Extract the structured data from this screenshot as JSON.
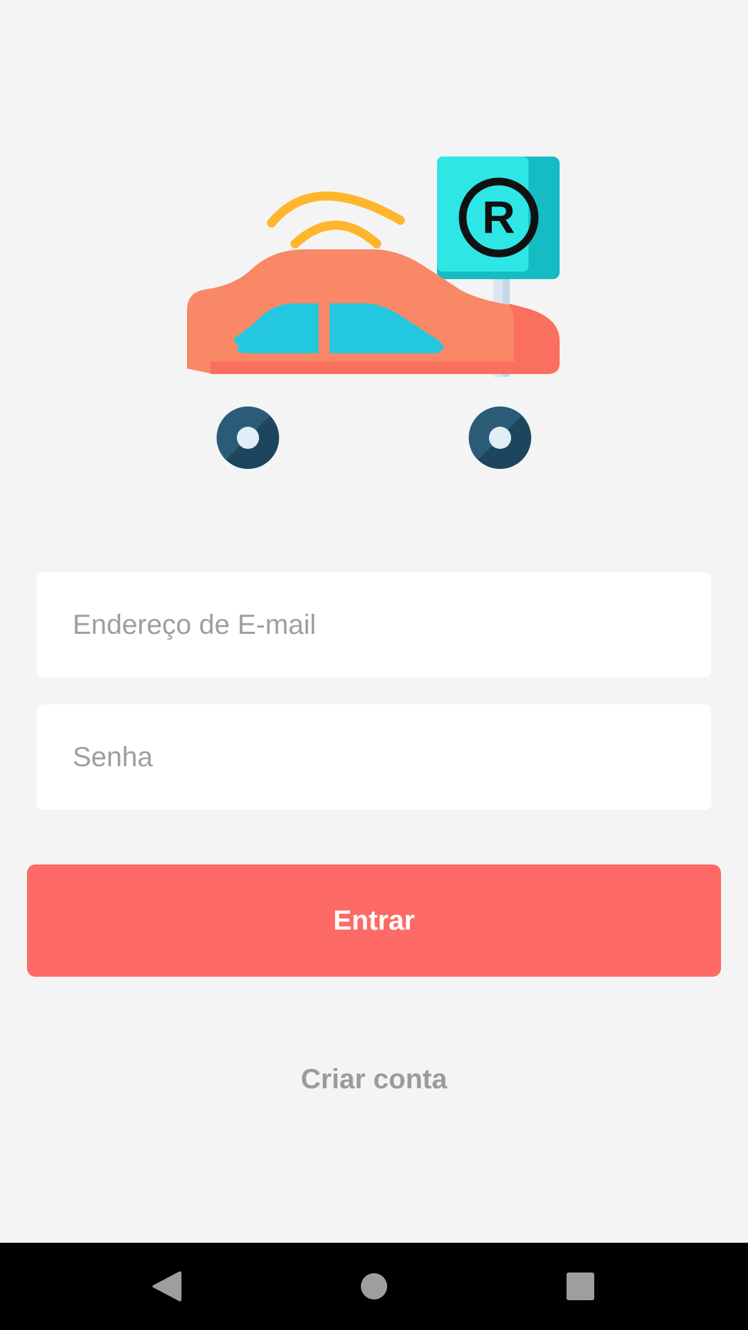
{
  "logo": {
    "icon": "car-with-parking-sign-and-wifi"
  },
  "form": {
    "email_placeholder": "Endereço de E-mail",
    "email_value": "",
    "password_placeholder": "Senha",
    "password_value": ""
  },
  "login_button_label": "Entrar",
  "create_account_label": "Criar conta",
  "colors": {
    "background": "#f4f4f4",
    "primary_button": "#fe6a66",
    "link_text": "#9b9b9b",
    "placeholder": "#9e9e9e"
  },
  "nav_bar": {
    "buttons": [
      "back-icon",
      "home-icon",
      "recent-apps-icon"
    ]
  }
}
